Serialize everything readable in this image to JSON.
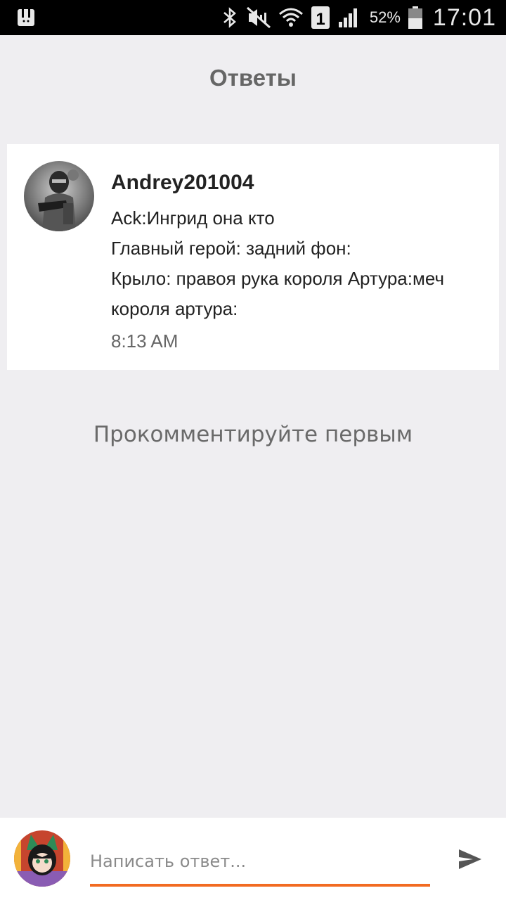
{
  "status_bar": {
    "battery_percent": "52%",
    "time": "17:01",
    "sim_label": "1",
    "icons": [
      "app-notification-icon",
      "bluetooth-icon",
      "mute-icon",
      "wifi-icon",
      "sim-icon",
      "signal-icon",
      "battery-icon"
    ]
  },
  "header": {
    "title": "Ответы"
  },
  "comment": {
    "author": "Andrey201004",
    "lines": [
      "Ack:Ингрид она кто",
      "Главный герой: задний фон:",
      "Крыло: правоя рука короля Артура:меч",
      "короля артура:"
    ],
    "time": "8:13 AM"
  },
  "empty_state": "Прокомментируйте первым",
  "reply": {
    "placeholder": "Написать ответ...",
    "accent_color": "#f26b21",
    "send_icon": "send-icon"
  }
}
